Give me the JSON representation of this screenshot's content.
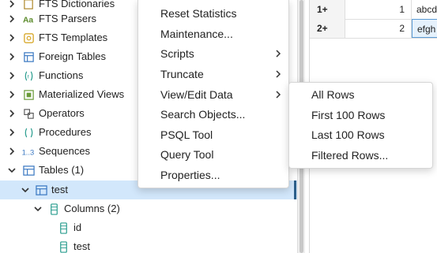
{
  "tree": {
    "items": [
      {
        "label": "FTS Dictionaries",
        "icon": "fts-dictionary-icon"
      },
      {
        "label": "FTS Parsers",
        "icon": "fts-parser-icon"
      },
      {
        "label": "FTS Templates",
        "icon": "fts-template-icon"
      },
      {
        "label": "Foreign Tables",
        "icon": "foreign-table-icon"
      },
      {
        "label": "Functions",
        "icon": "function-icon"
      },
      {
        "label": "Materialized Views",
        "icon": "materialized-view-icon"
      },
      {
        "label": "Operators",
        "icon": "operator-icon"
      },
      {
        "label": "Procedures",
        "icon": "procedure-icon"
      },
      {
        "label": "Sequences",
        "icon": "sequence-icon"
      },
      {
        "label": "Tables (1)",
        "icon": "tables-icon"
      },
      {
        "label": "test",
        "icon": "table-icon"
      },
      {
        "label": "Columns (2)",
        "icon": "columns-icon"
      },
      {
        "label": "id",
        "icon": "column-icon"
      },
      {
        "label": "test",
        "icon": "column-icon"
      }
    ]
  },
  "grid": {
    "rows": [
      {
        "header": "1+",
        "id": "1",
        "text": "abcd"
      },
      {
        "header": "2+",
        "id": "2",
        "text": "efgh"
      }
    ]
  },
  "context_menu": {
    "items": [
      {
        "label": "Reset Statistics",
        "submenu": false
      },
      {
        "label": "Maintenance...",
        "submenu": false
      },
      {
        "label": "Scripts",
        "submenu": true
      },
      {
        "label": "Truncate",
        "submenu": true
      },
      {
        "label": "View/Edit Data",
        "submenu": true
      },
      {
        "label": "Search Objects...",
        "submenu": false
      },
      {
        "label": "PSQL Tool",
        "submenu": false
      },
      {
        "label": "Query Tool",
        "submenu": false
      },
      {
        "label": "Properties...",
        "submenu": false
      }
    ]
  },
  "submenu": {
    "items": [
      {
        "label": "All Rows"
      },
      {
        "label": "First 100 Rows"
      },
      {
        "label": "Last 100 Rows"
      },
      {
        "label": "Filtered Rows..."
      }
    ]
  },
  "colors": {
    "selection": "#d2e7fb",
    "icon_teal": "#2a9d8f",
    "icon_blue": "#3a78c2"
  }
}
